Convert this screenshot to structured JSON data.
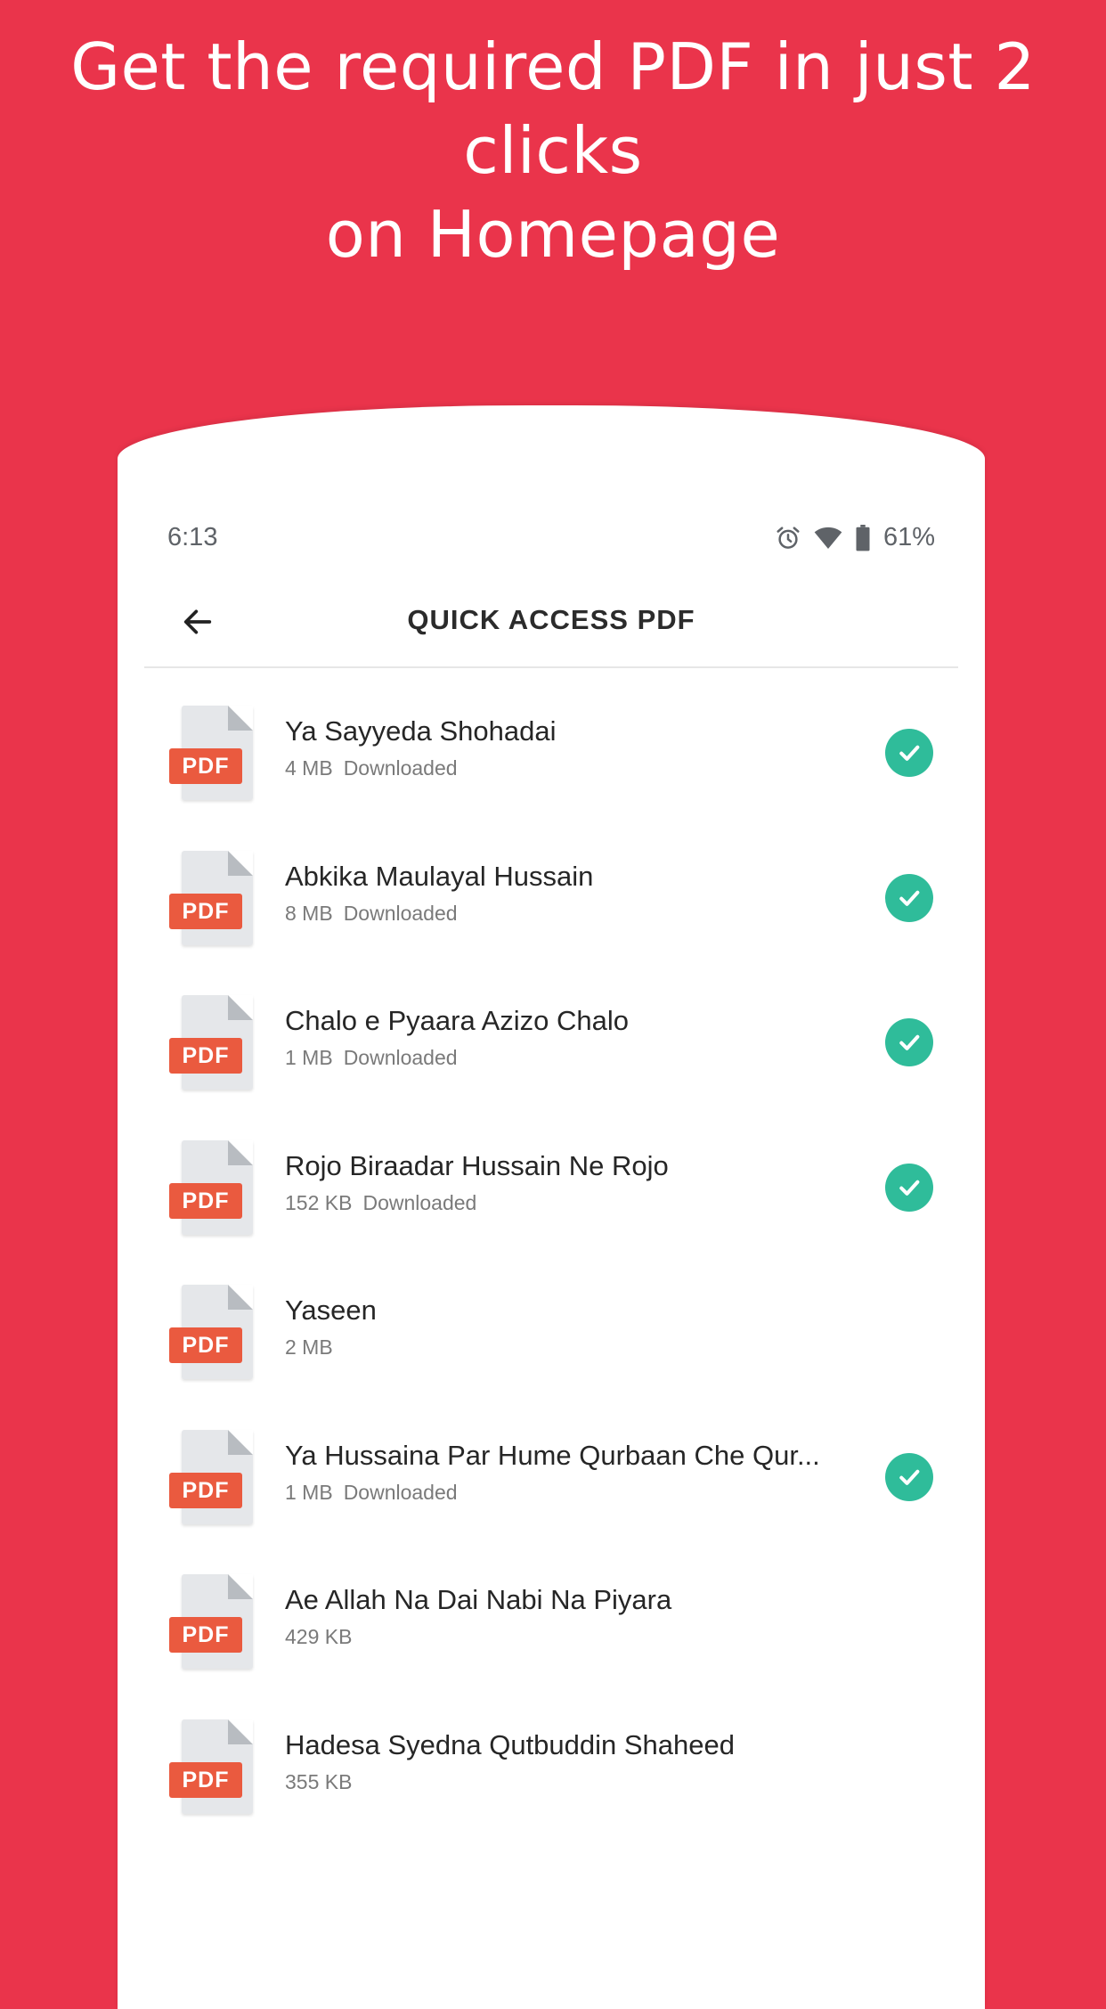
{
  "promo": {
    "title_line1": "Get the required PDF in just 2 clicks",
    "title_line2": "on Homepage"
  },
  "status_bar": {
    "time": "6:13",
    "battery": "61%",
    "icons": [
      "alarm-icon",
      "wifi-icon",
      "battery-icon"
    ]
  },
  "app_bar": {
    "back_icon": "arrow-left-icon",
    "title": "QUICK ACCESS PDF"
  },
  "file_icon_label": "PDF",
  "colors": {
    "background": "#ea344b",
    "pdf_badge": "#ea5a3f",
    "check": "#2fbc9a"
  },
  "files": [
    {
      "name": "Ya Sayyeda Shohadai",
      "size": "4 MB",
      "status": "Downloaded",
      "downloaded": true
    },
    {
      "name": "Abkika Maulayal Hussain",
      "size": "8 MB",
      "status": "Downloaded",
      "downloaded": true
    },
    {
      "name": "Chalo e Pyaara Azizo Chalo",
      "size": "1 MB",
      "status": "Downloaded",
      "downloaded": true
    },
    {
      "name": "Rojo Biraadar Hussain Ne Rojo",
      "size": "152 KB",
      "status": "Downloaded",
      "downloaded": true
    },
    {
      "name": "Yaseen",
      "size": "2 MB",
      "status": "",
      "downloaded": false
    },
    {
      "name": "Ya Hussaina Par Hume Qurbaan Che Qur...",
      "size": "1 MB",
      "status": "Downloaded",
      "downloaded": true
    },
    {
      "name": "Ae Allah Na Dai Nabi Na Piyara",
      "size": "429 KB",
      "status": "",
      "downloaded": false
    },
    {
      "name": "Hadesa Syedna Qutbuddin Shaheed",
      "size": "355 KB",
      "status": "",
      "downloaded": false
    }
  ]
}
